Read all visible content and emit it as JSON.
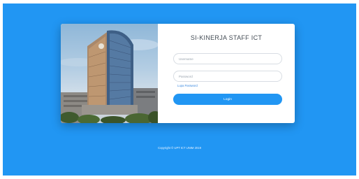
{
  "app_title": "SI-KINERJA STAFF ICT",
  "form": {
    "username_placeholder": "Username",
    "password_placeholder": "Password",
    "forgot_label": "Lupa Password",
    "login_label": "Login"
  },
  "footer": {
    "copyright": "Copyright © UPT ICT UNIM 2019"
  },
  "colors": {
    "background": "#2196f3",
    "card": "#ffffff",
    "button": "#2196f3",
    "link": "#3d8be0"
  },
  "image": {
    "subject": "campus-tower-building-photo"
  }
}
